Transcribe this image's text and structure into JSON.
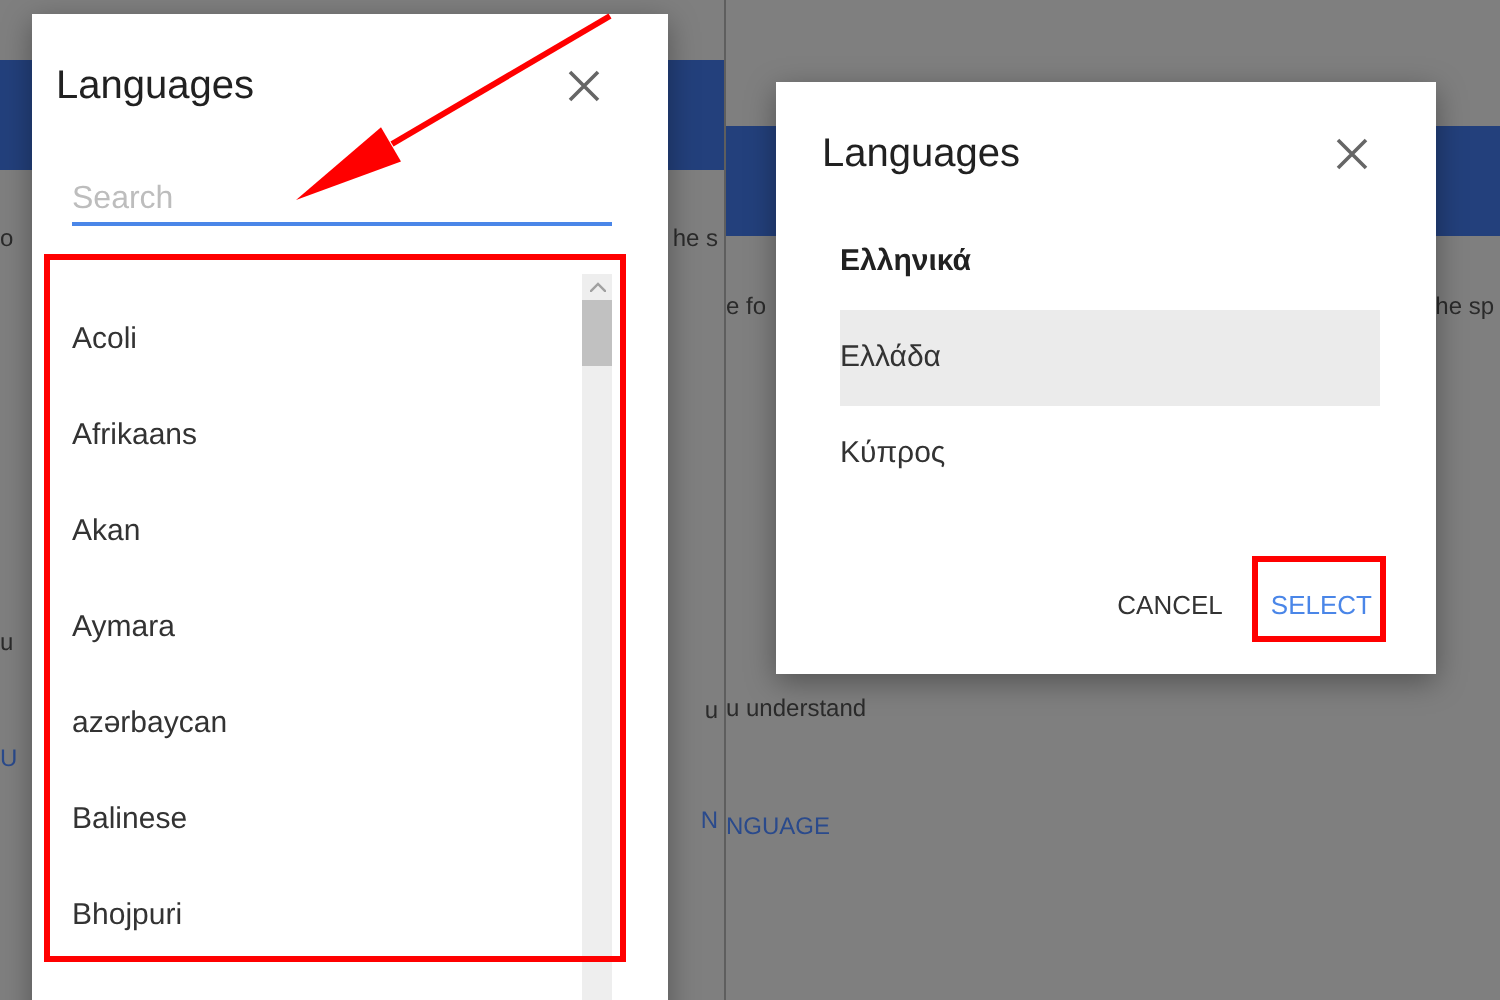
{
  "left_screen": {
    "background": {
      "rows": [
        {
          "left": {
            "text": "o",
            "kind": "text"
          },
          "right": {
            "text": "he s",
            "kind": "text"
          }
        },
        {
          "left": {
            "text": "u",
            "kind": "text"
          }
        },
        {
          "right": {
            "text": "u",
            "kind": "text"
          }
        },
        {
          "left": {
            "text": "U",
            "kind": "link"
          }
        },
        {
          "right": {
            "text": "N",
            "kind": "link"
          }
        }
      ]
    },
    "dialog": {
      "title": "Languages",
      "search": {
        "placeholder": "Search"
      },
      "items": [
        {
          "label": "Acoli",
          "selected": false
        },
        {
          "label": "Afrikaans",
          "selected": false
        },
        {
          "label": "Akan",
          "selected": false
        },
        {
          "label": "Aymara",
          "selected": false
        },
        {
          "label": "azərbaycan",
          "selected": false
        },
        {
          "label": "Balinese",
          "selected": false
        },
        {
          "label": "Bhojpuri",
          "selected": false
        }
      ]
    }
  },
  "right_screen": {
    "background": {
      "rows": [
        {
          "left": {
            "text": "e fo",
            "kind": "text"
          },
          "right": {
            "text": "he sp",
            "kind": "text"
          }
        },
        {
          "left": {
            "text": "u understand",
            "kind": "text"
          }
        },
        {
          "left": {
            "text": "NGUAGE",
            "kind": "link"
          }
        }
      ]
    },
    "dialog": {
      "title": "Languages",
      "group_label": "Ελληνικά",
      "items": [
        {
          "label": "Ελλάδα",
          "selected": true
        },
        {
          "label": "Κύπρος",
          "selected": false
        }
      ],
      "buttons": [
        {
          "label": "CANCEL",
          "kind": "text"
        },
        {
          "label": "SELECT",
          "kind": "primary"
        }
      ]
    }
  }
}
